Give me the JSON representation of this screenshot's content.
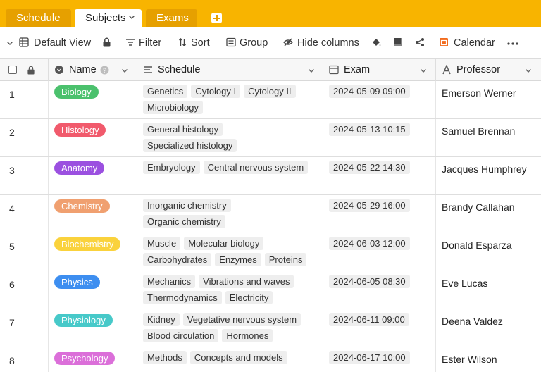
{
  "tabs": [
    {
      "label": "Schedule"
    },
    {
      "label": "Subjects"
    },
    {
      "label": "Exams"
    }
  ],
  "toolbar": {
    "view_label": "Default View",
    "filter_label": "Filter",
    "sort_label": "Sort",
    "group_label": "Group",
    "hide_columns_label": "Hide columns",
    "calendar_label": "Calendar"
  },
  "columns": {
    "name": "Name",
    "schedule": "Schedule",
    "exam": "Exam",
    "professor": "Professor"
  },
  "colors": {
    "tab_bar": "#f8b400",
    "calendar_icon": "#f26b1d"
  },
  "rows": [
    {
      "num": "1",
      "name": "Biology",
      "color": "#4bc16d",
      "schedule": [
        "Genetics",
        "Cytology I",
        "Cytology II",
        "Microbiology"
      ],
      "exam": "2024-05-09 09:00",
      "professor": "Emerson Werner"
    },
    {
      "num": "2",
      "name": "Histology",
      "color": "#f15a6c",
      "schedule": [
        "General histology",
        "Specialized histology"
      ],
      "exam": "2024-05-13 10:15",
      "professor": "Samuel Brennan"
    },
    {
      "num": "3",
      "name": "Anatomy",
      "color": "#9b50e0",
      "schedule": [
        "Embryology",
        "Central nervous system"
      ],
      "exam": "2024-05-22 14:30",
      "professor": "Jacques Humphrey"
    },
    {
      "num": "4",
      "name": "Chemistry",
      "color": "#f0a070",
      "schedule": [
        "Inorganic chemistry",
        "Organic chemistry"
      ],
      "exam": "2024-05-29 16:00",
      "professor": "Brandy Callahan"
    },
    {
      "num": "5",
      "name": "Biochemistry",
      "color": "#fad23c",
      "schedule": [
        "Muscle",
        "Molecular biology",
        "Carbohydrates",
        "Enzymes",
        "Proteins"
      ],
      "exam": "2024-06-03 12:00",
      "professor": "Donald Esparza"
    },
    {
      "num": "6",
      "name": "Physics",
      "color": "#3d8ef0",
      "schedule": [
        "Mechanics",
        "Vibrations and waves",
        "Thermodynamics",
        "Electricity"
      ],
      "exam": "2024-06-05 08:30",
      "professor": "Eve Lucas"
    },
    {
      "num": "7",
      "name": "Physiology",
      "color": "#47c9c9",
      "schedule": [
        "Kidney",
        "Vegetative nervous system",
        "Blood circulation",
        "Hormones"
      ],
      "exam": "2024-06-11 09:00",
      "professor": "Deena Valdez"
    },
    {
      "num": "8",
      "name": "Psychology",
      "color": "#db6fd9",
      "schedule": [
        "Methods",
        "Concepts and models"
      ],
      "exam": "2024-06-17 10:00",
      "professor": "Ester Wilson"
    }
  ]
}
